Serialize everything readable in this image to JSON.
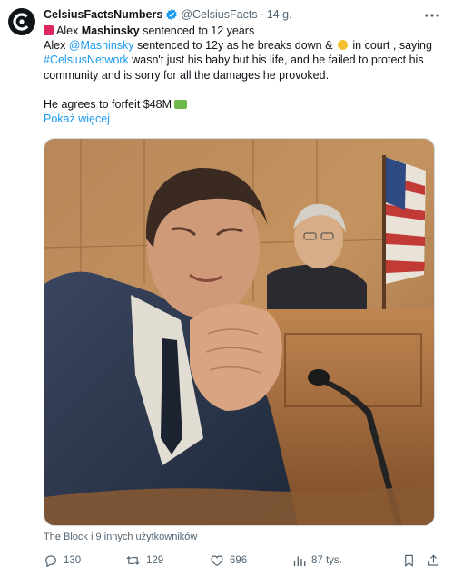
{
  "author": {
    "display_name": "CelsiusFactsNumbers",
    "handle": "@CelsiusFacts",
    "separator": "·",
    "time": "14 g."
  },
  "tweet": {
    "line1_prefix": "Alex ",
    "line1_bold": "Mashinsky",
    "line1_suffix": " sentenced to 12 years",
    "p1_a": "Alex ",
    "p1_mention": "@Mashinsky",
    "p1_b": " sentenced to 12y as he breaks down & ",
    "p1_c": " in court ,",
    "p1_d": " saying ",
    "p1_hashtag": "#CelsiusNetwork",
    "p1_e": " wasn't just his baby but his life, and he failed to protect his community and is sorry for all the damages he provoked.",
    "p2": "He agrees to forfeit $48M",
    "show_more": "Pokaż więcej"
  },
  "tagged_users": "The Block i 9 innych użytkowników",
  "stats": {
    "replies": "130",
    "reposts": "129",
    "likes": "696",
    "views": "87 tys."
  },
  "icons": {
    "reply": "reply-icon",
    "repost": "repost-icon",
    "like": "heart-icon",
    "views": "views-chart-icon",
    "bookmark": "bookmark-icon",
    "share": "share-icon",
    "more": "more-dots-icon",
    "verified": "verified-badge-icon"
  },
  "colors": {
    "link": "#1d9bf0",
    "secondary_text": "#536471",
    "verified": "#1d9bf0"
  }
}
